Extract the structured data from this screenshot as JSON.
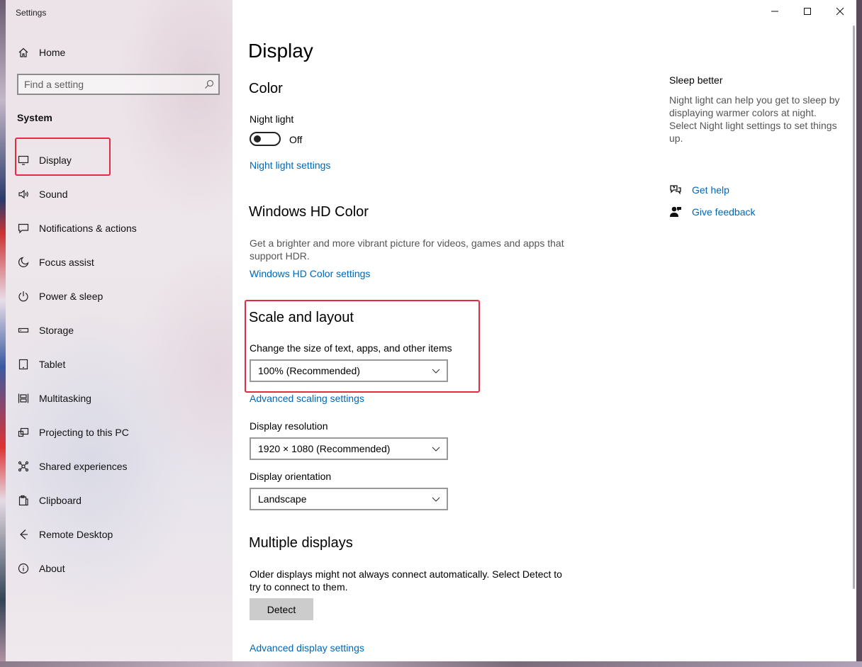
{
  "window": {
    "title": "Settings",
    "controls": {
      "minimize": "minimize",
      "maximize": "maximize",
      "close": "close"
    }
  },
  "sidebar": {
    "home_label": "Home",
    "search": {
      "placeholder": "Find a setting",
      "value": ""
    },
    "section_label": "System",
    "items": [
      {
        "label": "Display",
        "icon": "monitor-icon",
        "selected": true
      },
      {
        "label": "Sound",
        "icon": "speaker-icon"
      },
      {
        "label": "Notifications & actions",
        "icon": "message-icon"
      },
      {
        "label": "Focus assist",
        "icon": "moon-icon"
      },
      {
        "label": "Power & sleep",
        "icon": "power-icon"
      },
      {
        "label": "Storage",
        "icon": "storage-icon"
      },
      {
        "label": "Tablet",
        "icon": "tablet-icon"
      },
      {
        "label": "Multitasking",
        "icon": "multitasking-icon"
      },
      {
        "label": "Projecting to this PC",
        "icon": "projector-icon"
      },
      {
        "label": "Shared experiences",
        "icon": "shared-icon"
      },
      {
        "label": "Clipboard",
        "icon": "clipboard-icon"
      },
      {
        "label": "Remote Desktop",
        "icon": "remote-desktop-icon"
      },
      {
        "label": "About",
        "icon": "info-icon"
      }
    ]
  },
  "main": {
    "page_title": "Display",
    "color": {
      "title": "Color",
      "night_light_label": "Night light",
      "night_light_state": "Off",
      "night_light_on": false,
      "night_light_settings_link": "Night light settings"
    },
    "hd_color": {
      "title": "Windows HD Color",
      "description": "Get a brighter and more vibrant picture for videos, games and apps that support HDR.",
      "settings_link": "Windows HD Color settings"
    },
    "scale": {
      "title": "Scale and layout",
      "size_label": "Change the size of text, apps, and other items",
      "size_value": "100% (Recommended)",
      "advanced_link": "Advanced scaling settings",
      "resolution_label": "Display resolution",
      "resolution_value": "1920 × 1080 (Recommended)",
      "orientation_label": "Display orientation",
      "orientation_value": "Landscape"
    },
    "multiple": {
      "title": "Multiple displays",
      "description": "Older displays might not always connect automatically. Select Detect to try to connect to them.",
      "detect_button": "Detect",
      "advanced_display_link": "Advanced display settings"
    }
  },
  "side_panel": {
    "title": "Sleep better",
    "description": "Night light can help you get to sleep by displaying warmer colors at night. Select Night light settings to set things up.",
    "get_help": "Get help",
    "give_feedback": "Give feedback"
  },
  "colors": {
    "accent_link": "#0067b8",
    "highlight_annotation": "#e32b42"
  }
}
